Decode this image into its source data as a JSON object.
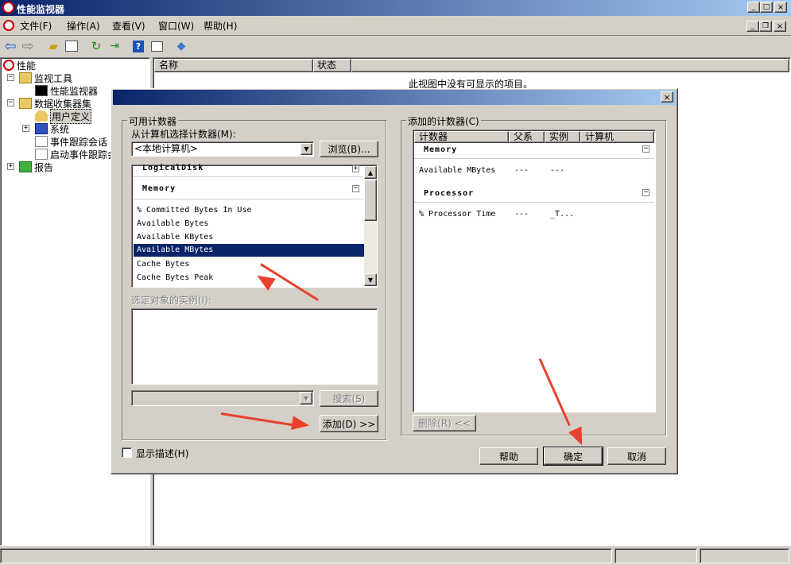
{
  "window": {
    "title": "性能监视器",
    "controls": [
      "_",
      "□",
      "×"
    ]
  },
  "menu": [
    "文件(F)",
    "操作(A)",
    "查看(V)",
    "窗口(W)",
    "帮助(H)"
  ],
  "tree": {
    "root": "性能",
    "monitor_tools": "监视工具",
    "perf_monitor": "性能监视器",
    "data_collector_sets": "数据收集器集",
    "user_defined": "用户定义",
    "system": "系统",
    "event_trace": "事件跟踪会话",
    "startup_trace": "启动事件跟踪会",
    "reports": "报告"
  },
  "list": {
    "col_name": "名称",
    "col_status": "状态",
    "empty_msg": "此视图中没有可显示的项目。"
  },
  "dialog": {
    "available_label": "可用计数器",
    "select_from_label": "从计算机选择计数器(M):",
    "computer_value": "<本地计算机>",
    "browse_btn": "浏览(B)...",
    "instances_label": "选定对象的实例(I):",
    "search_btn": "搜索(S)",
    "add_btn": "添加(D) >>",
    "show_desc": "显示描述(H)",
    "added_label": "添加的计数器(C)",
    "added_cols": {
      "counter": "计数器",
      "parent": "父系",
      "instance": "实例",
      "computer": "计算机"
    },
    "remove_btn": "删除(R) <<",
    "help_btn": "帮助",
    "ok_btn": "确定",
    "cancel_btn": "取消",
    "available_counters": {
      "partial_group": "LogicalDisk",
      "group": "Memory",
      "items": [
        "% Committed Bytes In Use",
        "Available Bytes",
        "Available KBytes",
        "Available MBytes",
        "Cache Bytes",
        "Cache Bytes Peak"
      ],
      "selected_item": "Available MBytes"
    },
    "added_counters": [
      {
        "group": "Memory",
        "counter": "Available MBytes",
        "parent": "---",
        "instance": "---"
      },
      {
        "group": "Processor",
        "counter": "% Processor Time",
        "parent": "---",
        "instance": "_T..."
      }
    ]
  }
}
